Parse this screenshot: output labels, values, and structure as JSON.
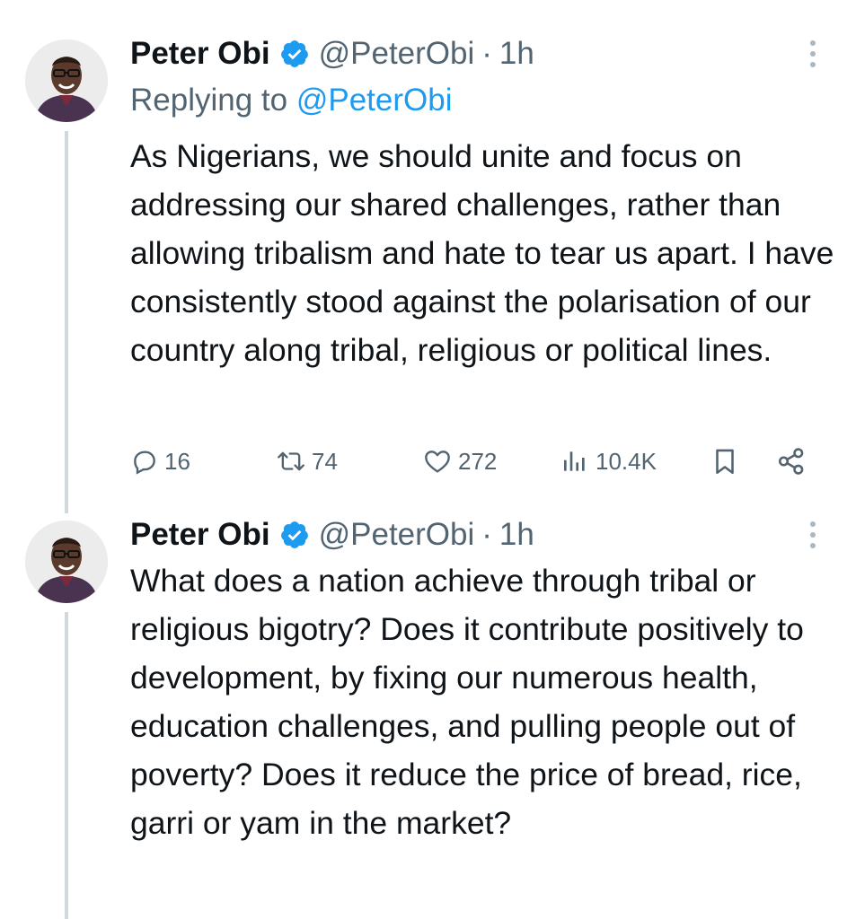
{
  "tweets": [
    {
      "author_name": "Peter Obi",
      "verified_icon": "verified-badge-icon",
      "handle": "@PeterObi",
      "separator": "·",
      "time": "1h",
      "replying_prefix": "Replying to ",
      "replying_to": "@PeterObi",
      "text": "As Nigerians, we should unite and focus on addressing our shared challenges, rather than allowing tribalism and hate to tear us apart. I have consistently stood against the polarisation of our country along tribal, religious or political lines.",
      "actions": {
        "replies": "16",
        "retweets": "74",
        "likes": "272",
        "views": "10.4K"
      }
    },
    {
      "author_name": "Peter Obi",
      "verified_icon": "verified-badge-icon",
      "handle": "@PeterObi",
      "separator": "·",
      "time": "1h",
      "text": "What does a nation achieve through tribal or religious bigotry? Does it contribute positively to development, by fixing our numerous health, education challenges, and pulling people out of poverty? Does it reduce the price of bread, rice, garri or yam in the market?"
    }
  ],
  "colors": {
    "text_primary": "#0f1419",
    "text_secondary": "#536471",
    "link": "#1d9bf0",
    "verified": "#1d9bf0",
    "thread_line": "#cfd9de"
  },
  "icons": {
    "reply": "reply-icon",
    "retweet": "retweet-icon",
    "like": "heart-icon",
    "views": "views-icon",
    "bookmark": "bookmark-icon",
    "share": "share-icon",
    "more": "more-options-icon"
  }
}
